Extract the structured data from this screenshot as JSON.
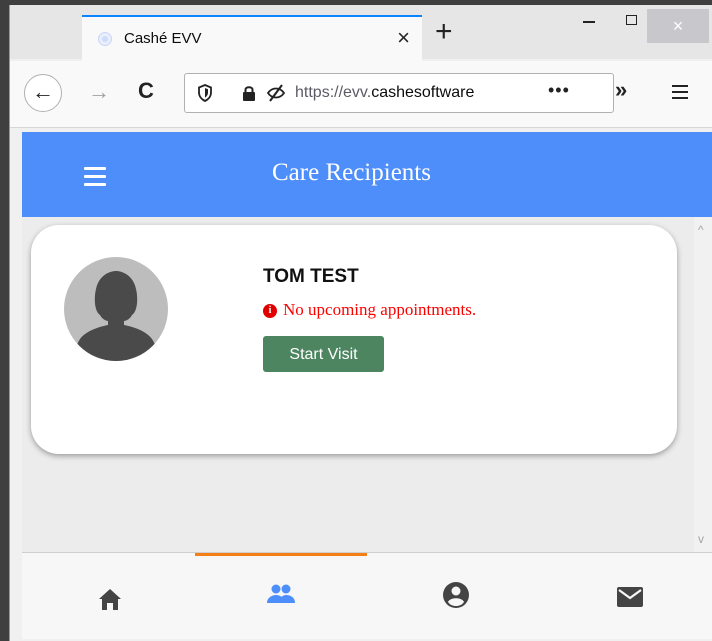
{
  "browser": {
    "tab_title": "Cashé EVV",
    "tab_close": "×",
    "new_tab": "+",
    "win_close": "×",
    "back": "←",
    "forward": "→",
    "reload": "C",
    "url_prefix": "https://evv.",
    "url_domain": "cashesoftware",
    "url_more": "•••",
    "overflow": "»"
  },
  "app": {
    "title": "Care Recipients",
    "header_color": "#4d8efb",
    "recipient": {
      "name": "TOM TEST",
      "status_icon": "i",
      "status_text": "No upcoming appointments.",
      "status_color": "#ff0000",
      "action_label": "Start Visit",
      "action_color": "#4d8561"
    },
    "bottom_nav": {
      "active_index": 1,
      "indicator_color": "#f57f17",
      "items": [
        "home-icon",
        "people-icon",
        "account-circle-icon",
        "mail-icon"
      ]
    }
  },
  "scrollbar": {
    "up": "^",
    "down": "v"
  }
}
